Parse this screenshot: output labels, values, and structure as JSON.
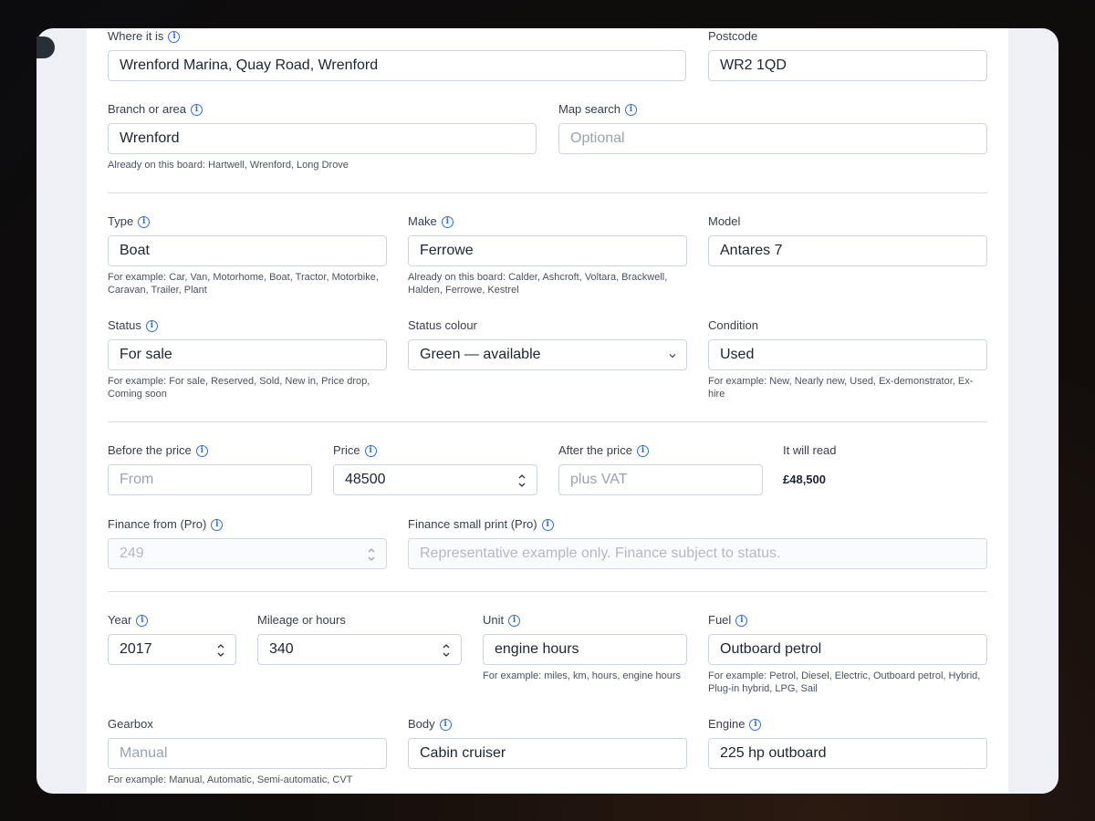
{
  "location": {
    "where": {
      "label": "Where it is",
      "value": "Wrenford Marina, Quay Road, Wrenford"
    },
    "postcode": {
      "label": "Postcode",
      "value": "WR2 1QD"
    },
    "branch": {
      "label": "Branch or area",
      "value": "Wrenford",
      "hint": "Already on this board: Hartwell, Wrenford, Long Drove"
    },
    "map_search": {
      "label": "Map search",
      "placeholder": "Optional"
    }
  },
  "vehicle": {
    "type": {
      "label": "Type",
      "value": "Boat",
      "hint": "For example: Car, Van, Motorhome, Boat, Tractor, Motorbike, Caravan, Trailer, Plant"
    },
    "make": {
      "label": "Make",
      "value": "Ferrowe",
      "hint": "Already on this board: Calder, Ashcroft, Voltara, Brackwell, Halden, Ferrowe, Kestrel"
    },
    "model": {
      "label": "Model",
      "value": "Antares 7"
    },
    "status": {
      "label": "Status",
      "value": "For sale",
      "hint": "For example: For sale, Reserved, Sold, New in, Price drop, Coming soon"
    },
    "status_colour": {
      "label": "Status colour",
      "value": "Green — available"
    },
    "condition": {
      "label": "Condition",
      "value": "Used",
      "hint": "For example: New, Nearly new, Used, Ex-demonstrator, Ex-hire"
    }
  },
  "pricing": {
    "before": {
      "label": "Before the price",
      "placeholder": "From"
    },
    "price": {
      "label": "Price",
      "value": "48500"
    },
    "after": {
      "label": "After the price",
      "placeholder": "plus VAT"
    },
    "reads": {
      "label": "It will read",
      "value": "£48,500"
    },
    "finance_from": {
      "label": "Finance from (Pro)",
      "placeholder": "249"
    },
    "finance_print": {
      "label": "Finance small print (Pro)",
      "placeholder": "Representative example only. Finance subject to status."
    }
  },
  "specs": {
    "year": {
      "label": "Year",
      "value": "2017"
    },
    "mileage": {
      "label": "Mileage or hours",
      "value": "340"
    },
    "unit": {
      "label": "Unit",
      "value": "engine hours",
      "hint": "For example: miles, km, hours, engine hours"
    },
    "fuel": {
      "label": "Fuel",
      "value": "Outboard petrol",
      "hint": "For example: Petrol, Diesel, Electric, Outboard petrol, Hybrid, Plug-in hybrid, LPG, Sail"
    },
    "gearbox": {
      "label": "Gearbox",
      "placeholder": "Manual",
      "hint": "For example: Manual, Automatic, Semi-automatic, CVT"
    },
    "body": {
      "label": "Body",
      "value": "Cabin cruiser"
    },
    "engine": {
      "label": "Engine",
      "value": "225 hp outboard"
    }
  },
  "colors": {
    "accent": "#2e6fe0",
    "border": "#c9d5e6",
    "panel": "#ffffff",
    "backdrop": "#eef0f5"
  }
}
